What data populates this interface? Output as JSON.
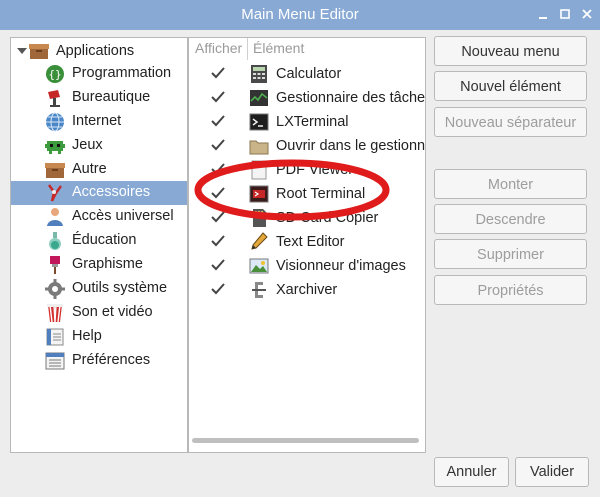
{
  "window": {
    "title": "Main Menu Editor"
  },
  "categories": {
    "root_label": "Applications",
    "items": [
      {
        "label": "Programmation",
        "icon": "programming-icon"
      },
      {
        "label": "Bureautique",
        "icon": "office-icon"
      },
      {
        "label": "Internet",
        "icon": "internet-globe-icon"
      },
      {
        "label": "Jeux",
        "icon": "games-icon"
      },
      {
        "label": "Autre",
        "icon": "folder-box-icon"
      },
      {
        "label": "Accessoires",
        "icon": "accessories-icon",
        "selected": true
      },
      {
        "label": "Accès universel",
        "icon": "universal-access-icon"
      },
      {
        "label": "Éducation",
        "icon": "education-flask-icon"
      },
      {
        "label": "Graphisme",
        "icon": "graphics-brush-icon"
      },
      {
        "label": "Outils système",
        "icon": "system-tools-gear-icon"
      },
      {
        "label": "Son et vidéo",
        "icon": "sound-video-icon"
      },
      {
        "label": "Help",
        "icon": "help-icon"
      },
      {
        "label": "Préférences",
        "icon": "preferences-icon"
      }
    ]
  },
  "items_list": {
    "col_show": "Afficher",
    "col_element": "Élément",
    "rows": [
      {
        "label": "Calculator",
        "checked": true,
        "icon": "calculator-icon"
      },
      {
        "label": "Gestionnaire des tâches",
        "checked": true,
        "icon": "task-manager-icon"
      },
      {
        "label": "LXTerminal",
        "checked": true,
        "icon": "terminal-icon"
      },
      {
        "label": "Ouvrir dans le gestionnaire",
        "checked": true,
        "icon": "file-manager-folder-icon"
      },
      {
        "label": "PDF Viewer",
        "checked": true,
        "icon": "pdf-viewer-icon"
      },
      {
        "label": "Root Terminal",
        "checked": true,
        "icon": "root-terminal-icon"
      },
      {
        "label": "SD Card Copier",
        "checked": true,
        "icon": "sd-card-icon"
      },
      {
        "label": "Text Editor",
        "checked": true,
        "icon": "text-editor-pen-icon"
      },
      {
        "label": "Visionneur d'images",
        "checked": true,
        "icon": "image-viewer-icon"
      },
      {
        "label": "Xarchiver",
        "checked": true,
        "icon": "archiver-clamp-icon"
      }
    ]
  },
  "buttons": {
    "new_menu": "Nouveau menu",
    "new_item": "Nouvel élément",
    "new_separator": "Nouveau séparateur",
    "move_up": "Monter",
    "move_down": "Descendre",
    "delete": "Supprimer",
    "properties": "Propriétés",
    "cancel": "Annuler",
    "ok": "Valider"
  },
  "colors": {
    "accent": "#87a9d4",
    "annotation_red": "#e01b1b"
  }
}
